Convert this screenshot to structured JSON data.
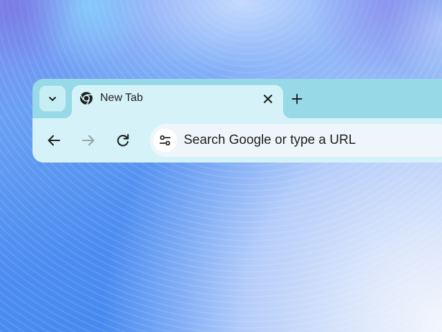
{
  "tab_strip": {
    "tab_search_icon": "chevron-down-icon",
    "tabs": [
      {
        "title": "New Tab",
        "favicon": "chrome-icon",
        "active": true,
        "close_icon": "close-icon"
      }
    ],
    "new_tab_icon": "plus-icon"
  },
  "toolbar": {
    "back_icon": "arrow-left-icon",
    "forward_icon": "arrow-right-icon",
    "forward_enabled": false,
    "reload_icon": "reload-icon",
    "omnibox": {
      "chip_icon": "tune-icon",
      "placeholder": "Search Google or type a URL"
    }
  },
  "colors": {
    "tab_strip_background": "#97d9e6",
    "active_tab_background": "#d4f2f8",
    "toolbar_background": "#d4f2f8",
    "omnibox_background": "#eef6fb",
    "icon": "#1f1f1f",
    "icon_disabled": "#9aa4a8",
    "text": "#1f1f1f"
  }
}
